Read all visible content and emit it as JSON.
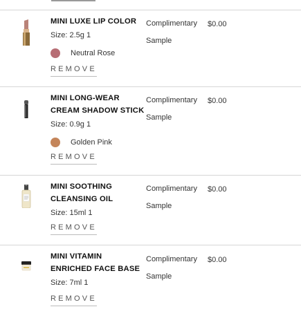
{
  "items": [
    {
      "name_line1": "MINI LUXE LIP COLOR",
      "name_line2": "",
      "size": "Size: 2.5g 1",
      "shade": {
        "name": "Neutral Rose",
        "color": "#b76d74"
      },
      "price_label_line1": "Complimentary",
      "price_label_line2": "Sample",
      "price": "$0.00",
      "remove_label": "REMOVE",
      "thumb_icon": "lipstick-icon"
    },
    {
      "name_line1": "MINI LONG-WEAR",
      "name_line2": "CREAM SHADOW STICK",
      "size": "Size: 0.9g 1",
      "shade": {
        "name": "Golden Pink",
        "color": "#c4855a"
      },
      "price_label_line1": "Complimentary",
      "price_label_line2": "Sample",
      "price": "$0.00",
      "remove_label": "REMOVE",
      "thumb_icon": "shadow-stick-icon"
    },
    {
      "name_line1": "MINI SOOTHING",
      "name_line2": "CLEANSING OIL",
      "size": "Size: 15ml 1",
      "shade": null,
      "price_label_line1": "Complimentary",
      "price_label_line2": "Sample",
      "price": "$0.00",
      "remove_label": "REMOVE",
      "thumb_icon": "oil-bottle-icon"
    },
    {
      "name_line1": "MINI VITAMIN",
      "name_line2": "ENRICHED FACE BASE",
      "size": "Size: 7ml 1",
      "shade": null,
      "price_label_line1": "Complimentary",
      "price_label_line2": "Sample",
      "price": "$0.00",
      "remove_label": "REMOVE",
      "thumb_icon": "cream-jar-icon"
    }
  ]
}
